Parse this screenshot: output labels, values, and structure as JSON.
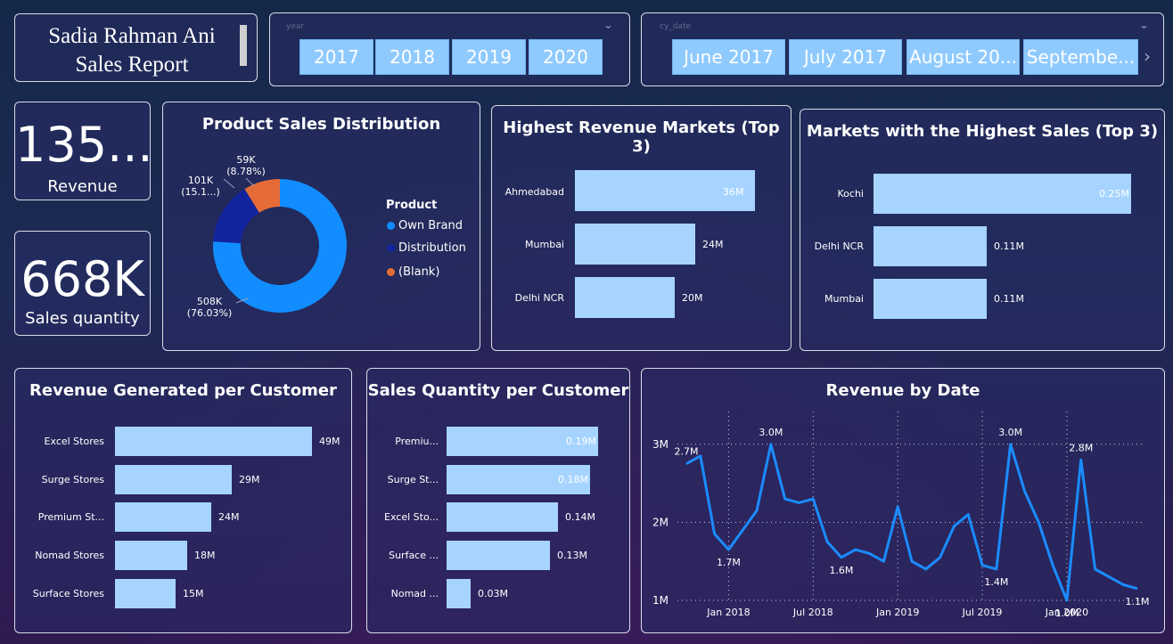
{
  "header": {
    "report_title_line1": "Sadia Rahman Ani",
    "report_title_line2": "Sales Report"
  },
  "year_slicer": {
    "label": "year",
    "items": [
      "2017",
      "2018",
      "2019",
      "2020"
    ]
  },
  "date_slicer": {
    "label": "cy_date",
    "items": [
      "June 2017",
      "July 2017",
      "August 20...",
      "Septembe..."
    ]
  },
  "kpis": {
    "revenue_value": "135...",
    "revenue_label": "Revenue",
    "quantity_value": "668K",
    "quantity_label": "Sales quantity"
  },
  "colors": {
    "bar": "#a6d4ff",
    "own_brand": "#118dff",
    "distribution": "#12239e",
    "blank": "#e66c37",
    "line": "#1a8cff"
  },
  "product_dist": {
    "title": "Product Sales Distribution",
    "legend_title": "Product",
    "chart_data": {
      "type": "pie",
      "slices": [
        {
          "name": "Own Brand",
          "value": 508,
          "label": "508K",
          "pct": "(76.03%)"
        },
        {
          "name": "Distribution",
          "value": 101,
          "label": "101K",
          "pct": "(15.1...)"
        },
        {
          "name": "(Blank)",
          "value": 59,
          "label": "59K",
          "pct": "(8.78%)"
        }
      ]
    }
  },
  "revenue_markets": {
    "title": "Highest Revenue Markets (Top 3)",
    "chart_data": {
      "type": "bar",
      "categories": [
        "Ahmedabad",
        "Mumbai",
        "Delhi NCR"
      ],
      "values": [
        36,
        24,
        20
      ],
      "labels": [
        "36M",
        "24M",
        "20M"
      ]
    }
  },
  "sales_markets": {
    "title": "Markets with the Highest Sales (Top 3)",
    "chart_data": {
      "type": "bar",
      "categories": [
        "Kochi",
        "Delhi NCR",
        "Mumbai"
      ],
      "values": [
        0.25,
        0.11,
        0.11
      ],
      "labels": [
        "0.25M",
        "0.11M",
        "0.11M"
      ]
    }
  },
  "revenue_customer": {
    "title": "Revenue Generated per Customer",
    "chart_data": {
      "type": "bar",
      "categories": [
        "Excel Stores",
        "Surge Stores",
        "Premium St...",
        "Nomad Stores",
        "Surface Stores"
      ],
      "values": [
        49,
        29,
        24,
        18,
        15
      ],
      "labels": [
        "49M",
        "29M",
        "24M",
        "18M",
        "15M"
      ]
    }
  },
  "qty_customer": {
    "title": "Sales Quantity per Customer",
    "chart_data": {
      "type": "bar",
      "categories": [
        "Premiu...",
        "Surge St...",
        "Excel Sto...",
        "Surface ...",
        "Nomad ..."
      ],
      "values": [
        0.19,
        0.18,
        0.14,
        0.13,
        0.03
      ],
      "labels": [
        "0.19M",
        "0.18M",
        "0.14M",
        "0.13M",
        "0.03M"
      ]
    }
  },
  "revenue_date": {
    "title": "Revenue by Date",
    "chart_data": {
      "type": "line",
      "x": [
        "2017-10",
        "2017-11",
        "2017-12",
        "2018-01",
        "2018-02",
        "2018-03",
        "2018-04",
        "2018-05",
        "2018-06",
        "2018-07",
        "2018-08",
        "2018-09",
        "2018-10",
        "2018-11",
        "2018-12",
        "2019-01",
        "2019-02",
        "2019-03",
        "2019-04",
        "2019-05",
        "2019-06",
        "2019-07",
        "2019-08",
        "2019-09",
        "2019-10",
        "2019-11",
        "2019-12",
        "2020-01",
        "2020-02",
        "2020-03",
        "2020-04",
        "2020-05",
        "2020-06"
      ],
      "values": [
        2.75,
        2.85,
        1.85,
        1.65,
        1.9,
        2.15,
        3.0,
        2.3,
        2.25,
        2.3,
        1.75,
        1.55,
        1.65,
        1.6,
        1.5,
        2.2,
        1.5,
        1.4,
        1.55,
        1.95,
        2.1,
        1.45,
        1.4,
        3.0,
        2.4,
        2.0,
        1.45,
        1.0,
        2.8,
        1.4,
        1.3,
        1.2,
        1.15
      ],
      "ylim": [
        1,
        3.1
      ],
      "yticks": [
        "1M",
        "2M",
        "3M"
      ],
      "xticks": [
        "Jan 2018",
        "Jul 2018",
        "Jan 2019",
        "Jul 2019",
        "Jan 2020"
      ],
      "annotations": [
        {
          "at": "2017-10",
          "text": "2.7M"
        },
        {
          "at": "2018-01",
          "text": "1.7M"
        },
        {
          "at": "2018-04",
          "text": "3.0M"
        },
        {
          "at": "2018-09",
          "text": "1.6M"
        },
        {
          "at": "2019-08",
          "text": "1.4M"
        },
        {
          "at": "2019-09",
          "text": "3.0M"
        },
        {
          "at": "2020-01",
          "text": "1.0M"
        },
        {
          "at": "2020-02",
          "text": "2.8M"
        },
        {
          "at": "2020-06",
          "text": "1.1M"
        }
      ]
    }
  }
}
